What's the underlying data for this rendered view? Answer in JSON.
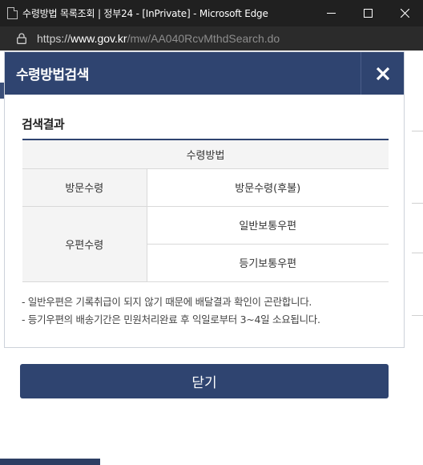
{
  "window": {
    "title": "수령방법 목록조회 | 정부24 - [InPrivate] - Microsoft Edge",
    "minimize_icon": "minimize-icon",
    "maximize_icon": "maximize-icon",
    "close_icon": "close-icon"
  },
  "address_bar": {
    "scheme": "https://",
    "host": "www.gov.kr",
    "path": "/mw/AA040RcvMthdSearch.do"
  },
  "modal": {
    "title": "수령방법검색",
    "section_title": "검색결과",
    "table": {
      "header": "수령방법",
      "rows": [
        {
          "category": "방문수령",
          "method": "방문수령(후불)"
        },
        {
          "category": "우편수령",
          "method": "일반보통우편"
        },
        {
          "category": "우편수령",
          "method": "등기보통우편"
        }
      ]
    },
    "notes": [
      "- 일반우편은 기록취급이 되지 않기 때문에 배달결과 확인이 곤란합니다.",
      "- 등기우편의 배송기간은 민원처리완료 후 익일로부터 3~4일 소요됩니다."
    ]
  },
  "close_button_label": "닫기",
  "colors": {
    "header_bg": "#2f4470",
    "titlebar_bg": "#202020",
    "addressbar_bg": "#2b2b2b"
  }
}
